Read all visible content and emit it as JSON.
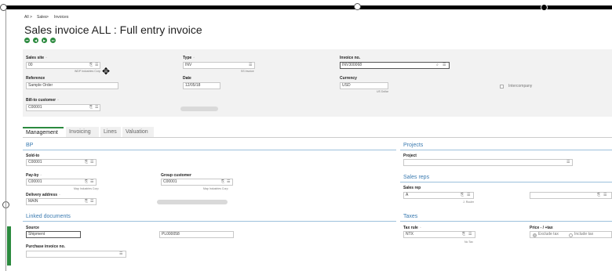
{
  "breadcrumb": [
    "All",
    "Sales",
    "Invoices"
  ],
  "breadcrumb_separator": ">",
  "page_title": "Sales invoice ALL : Full entry invoice",
  "nav_buttons": [
    "first",
    "previous",
    "next",
    "last"
  ],
  "header": {
    "sales_site": {
      "label": "Sales site",
      "value": "00",
      "sub": "WDP Industries Corp"
    },
    "type": {
      "label": "Type",
      "value": "INV",
      "sub": "SS Invoice"
    },
    "invoice_no": {
      "label": "Invoice no.",
      "value": "INV300068"
    },
    "reference": {
      "label": "Reference",
      "value": "Sample Order"
    },
    "date": {
      "label": "Date",
      "value": "12/05/18"
    },
    "currency": {
      "label": "Currency",
      "value": "USD",
      "sub": "US Dollar"
    },
    "intercompany": {
      "label": "Intercompany"
    },
    "bill_to": {
      "label": "Bill-to customer",
      "value": "C00001"
    }
  },
  "tabs": [
    "Management",
    "Invoicing",
    "Lines",
    "Valuation"
  ],
  "bp": {
    "title": "BP",
    "sold_to": {
      "label": "Sold-to",
      "value": "C00001"
    },
    "pay_by": {
      "label": "Pay-by",
      "value": "C00001",
      "sub": "Map Industries Corp"
    },
    "group_customer": {
      "label": "Group customer",
      "value": "C00001",
      "sub": "Map Industries Corp"
    },
    "delivery_address": {
      "label": "Delivery address",
      "value": "MAIN"
    }
  },
  "projects": {
    "title": "Projects",
    "project": {
      "label": "Project",
      "value": ""
    }
  },
  "sales_reps": {
    "title": "Sales reps",
    "sales_rep": {
      "label": "Sales rep",
      "value": "A",
      "sub": "J. Rouler"
    }
  },
  "linked": {
    "title": "Linked documents",
    "source": {
      "label": "Source",
      "value": "Shipment"
    },
    "source_doc": {
      "value": "PL000058"
    },
    "purchase_invoice": {
      "label": "Purchase invoice no.",
      "value": ""
    }
  },
  "taxes": {
    "title": "Taxes",
    "tax_rule": {
      "label": "Tax rule",
      "value": "NTX",
      "sub": "No Tax"
    },
    "price": {
      "label": "Price - / +tax",
      "options": [
        "Exclude tax",
        "Include tax"
      ]
    }
  },
  "colors": {
    "accent_green": "#2b8a3e",
    "section_blue": "#3a7ab0"
  }
}
